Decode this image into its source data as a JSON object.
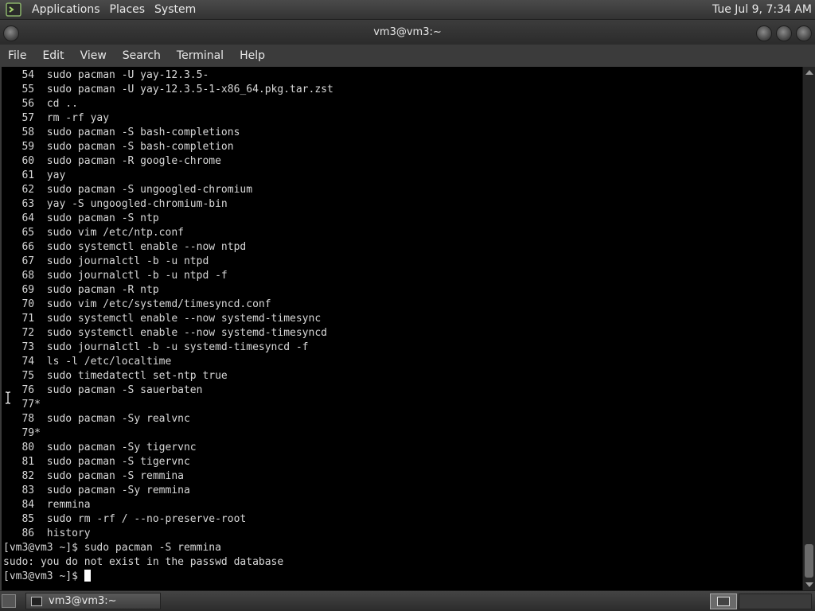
{
  "top_panel": {
    "menus": [
      "Applications",
      "Places",
      "System"
    ],
    "clock": "Tue Jul 9, 7:34 AM"
  },
  "window": {
    "title": "vm3@vm3:~"
  },
  "menubar": [
    "File",
    "Edit",
    "View",
    "Search",
    "Terminal",
    "Help"
  ],
  "terminal": {
    "lines": [
      "   54  sudo pacman -U yay-12.3.5-",
      "   55  sudo pacman -U yay-12.3.5-1-x86_64.pkg.tar.zst",
      "   56  cd ..",
      "   57  rm -rf yay",
      "   58  sudo pacman -S bash-completions",
      "   59  sudo pacman -S bash-completion",
      "   60  sudo pacman -R google-chrome",
      "   61  yay",
      "   62  sudo pacman -S ungoogled-chromium",
      "   63  yay -S ungoogled-chromium-bin",
      "   64  sudo pacman -S ntp",
      "   65  sudo vim /etc/ntp.conf",
      "   66  sudo systemctl enable --now ntpd",
      "   67  sudo journalctl -b -u ntpd",
      "   68  sudo journalctl -b -u ntpd -f",
      "   69  sudo pacman -R ntp",
      "   70  sudo vim /etc/systemd/timesyncd.conf",
      "   71  sudo systemctl enable --now systemd-timesync",
      "   72  sudo systemctl enable --now systemd-timesyncd",
      "   73  sudo journalctl -b -u systemd-timesyncd -f",
      "   74  ls -l /etc/localtime",
      "   75  sudo timedatectl set-ntp true",
      "   76  sudo pacman -S sauerbaten",
      "   77*",
      "   78  sudo pacman -Sy realvnc",
      "   79*",
      "   80  sudo pacman -Sy tigervnc",
      "   81  sudo pacman -S tigervnc",
      "   82  sudo pacman -S remmina",
      "   83  sudo pacman -Sy remmina",
      "   84  remmina",
      "   85  sudo rm -rf / --no-preserve-root",
      "   86  history",
      "[vm3@vm3 ~]$ sudo pacman -S remmina",
      "sudo: you do not exist in the passwd database"
    ],
    "prompt": "[vm3@vm3 ~]$ "
  },
  "taskbar": {
    "task_label": "vm3@vm3:~"
  },
  "icons": {
    "panel_logo": "terminal-logo-icon",
    "task": "terminal-icon",
    "show_desktop": "show-desktop-icon"
  },
  "colors": {
    "terminal_bg": "#000000",
    "terminal_fg": "#d8d8d8",
    "panel_bg": "#3b3b3b"
  }
}
